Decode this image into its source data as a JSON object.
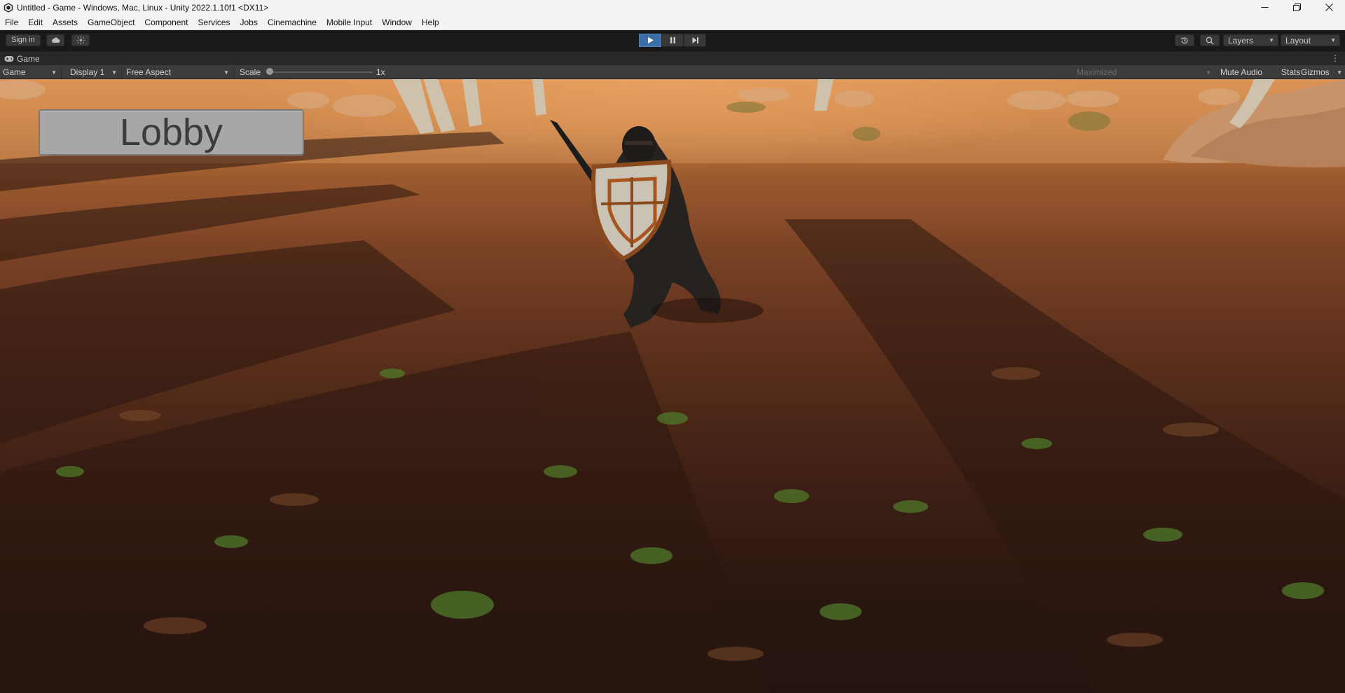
{
  "window": {
    "title": "Untitled - Game - Windows, Mac, Linux - Unity 2022.1.10f1 <DX11>"
  },
  "menu": {
    "items": [
      "File",
      "Edit",
      "Assets",
      "GameObject",
      "Component",
      "Services",
      "Jobs",
      "Cinemachine",
      "Mobile Input",
      "Window",
      "Help"
    ]
  },
  "toolbar": {
    "sign_in_label": "Sign in",
    "layers_label": "Layers",
    "layout_label": "Layout",
    "play_state": "playing"
  },
  "game_tab": {
    "label": "Game"
  },
  "game_bar": {
    "view_mode": "Game",
    "display": "Display 1",
    "aspect": "Free Aspect",
    "scale_label": "Scale",
    "scale_value": "1x",
    "play_mode_state": "Maximized",
    "mute_audio_label": "Mute Audio",
    "stats_label": "Stats",
    "gizmos_label": "Gizmos"
  },
  "game_view": {
    "lobby_button_label": "Lobby"
  },
  "colors": {
    "play_active": "#3c6fa8",
    "editor_dark": "#191919",
    "game_bar": "#3c3c3c"
  }
}
